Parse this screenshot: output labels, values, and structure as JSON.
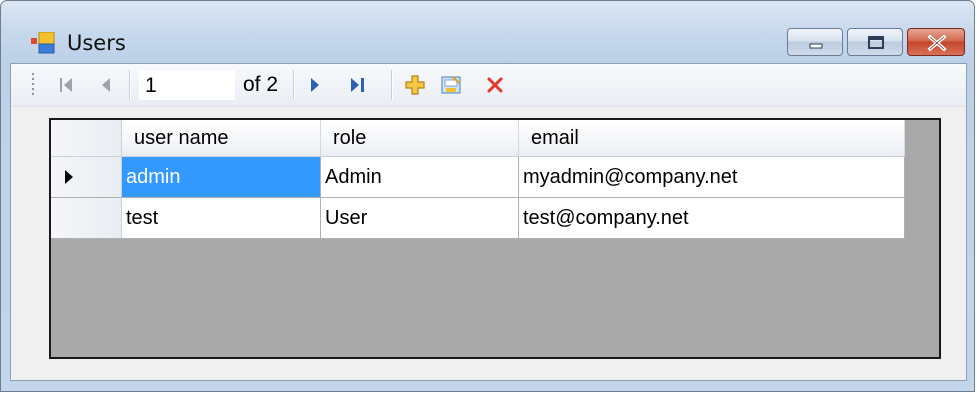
{
  "window": {
    "title": "Users",
    "icon": "app-form-icon",
    "buttons": [
      "minimize-icon",
      "maximize-icon",
      "close-icon"
    ]
  },
  "navigator": {
    "position": "1",
    "count_label": "of 2",
    "icons": [
      "move-first-icon",
      "move-previous-icon",
      "move-next-icon",
      "move-last-icon",
      "add-new-icon",
      "save-icon",
      "delete-icon"
    ]
  },
  "grid": {
    "columns": [
      "user name",
      "role",
      "email"
    ],
    "rows": [
      {
        "user_name": "admin",
        "role": "Admin",
        "email": "myadmin@company.net",
        "current": true
      },
      {
        "user_name": "test",
        "role": "User",
        "email": "test@company.net",
        "current": false
      }
    ]
  },
  "colors": {
    "selection": "#3399ff",
    "grid_background": "#a9a9a9",
    "delete_icon": "#e8352b",
    "nav_arrow": "#2e5fb3"
  }
}
